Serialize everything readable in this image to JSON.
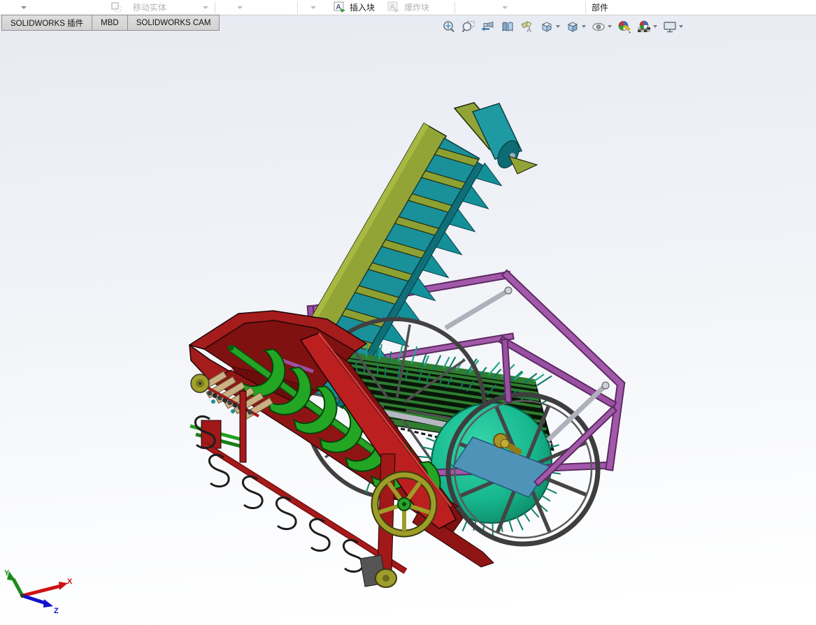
{
  "toolbar": {
    "move_entity": {
      "label": "移动实体",
      "enabled": false
    },
    "insert_block": {
      "label": "插入块",
      "enabled": true
    },
    "explode_block": {
      "label": "爆炸块",
      "enabled": false
    },
    "parts": {
      "label": "部件",
      "enabled": true
    }
  },
  "tabs": [
    {
      "label": "SOLIDWORKS 插件"
    },
    {
      "label": "MBD"
    },
    {
      "label": "SOLIDWORKS CAM"
    }
  ],
  "heads_up": {
    "icons": [
      {
        "name": "zoom-to-fit"
      },
      {
        "name": "zoom-to-area"
      },
      {
        "name": "previous-view"
      },
      {
        "name": "section-view"
      },
      {
        "name": "hide-show-annotations"
      },
      {
        "name": "view-orientation",
        "dropdown": true
      },
      {
        "name": "display-style",
        "dropdown": true
      },
      {
        "name": "hide-show-items",
        "dropdown": true
      },
      {
        "name": "edit-appearance"
      },
      {
        "name": "apply-scene",
        "dropdown": true
      },
      {
        "name": "view-settings",
        "dropdown": true
      }
    ]
  },
  "triad": {
    "x_label": "X",
    "y_label": "Y",
    "z_label": "Z",
    "x_color": "#cc1111",
    "y_color": "#1e8a1e",
    "z_color": "#1111cc"
  },
  "model": {
    "description": "agricultural picker assembly 3D model",
    "components": [
      {
        "name": "elevator-conveyor",
        "color": "#19909a",
        "rail_color": "#93a437"
      },
      {
        "name": "feed-hopper",
        "color": "#a51c1c"
      },
      {
        "name": "auger-screw",
        "color": "#23a623"
      },
      {
        "name": "picking-drum-slats",
        "color": "#2f7d30"
      },
      {
        "name": "picking-drum-spikes",
        "color": "#117a64"
      },
      {
        "name": "drum-end-disc",
        "color": "#17b88e"
      },
      {
        "name": "chassis-frame",
        "color": "#9a50a2"
      },
      {
        "name": "spoked-wheel",
        "color": "#474747"
      },
      {
        "name": "deflector-plate",
        "color": "#4f93b8"
      },
      {
        "name": "hub-shaft",
        "color": "#ad9327"
      },
      {
        "name": "drive-pulley",
        "color": "#9d9d28"
      },
      {
        "name": "spring-tines",
        "color": "#222222"
      },
      {
        "name": "slat-deck",
        "color": "#cab185"
      }
    ]
  },
  "background": {
    "top": "#e7eaf1",
    "bottom": "#ffffff"
  }
}
